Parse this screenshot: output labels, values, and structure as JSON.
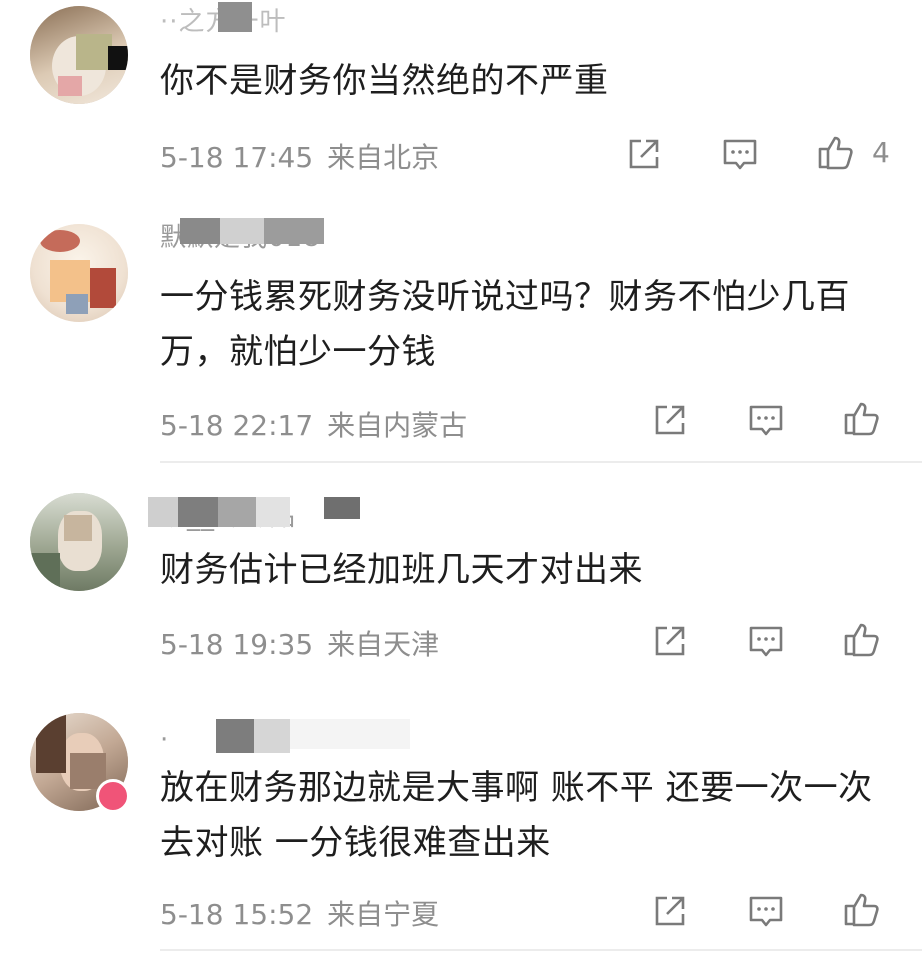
{
  "comments": [
    {
      "username": "··之方一叶",
      "text": "你不是财务你当然绝的不严重",
      "time": "5-18 17:45",
      "location": "来自北京",
      "likes": "4"
    },
    {
      "username": "默默是我018",
      "text": "一分钱累死财务没听说过吗？财务不怕少几百万，就怕少一分钱",
      "time": "5-18 22:17",
      "location": "来自内蒙古",
      "likes": ""
    },
    {
      "username": "珍__冬冬品",
      "text": "财务估计已经加班几天才对出来",
      "time": "5-18 19:35",
      "location": "来自天津",
      "likes": ""
    },
    {
      "username": "·",
      "text": "放在财务那边就是大事啊 账不平 还要一次一次去对账 一分钱很难查出来",
      "time": "5-18 15:52",
      "location": "来自宁夏",
      "likes": ""
    }
  ],
  "colors": {
    "text": "#1e1e1e",
    "meta": "#8e8e8e",
    "icon": "#7a7a7a",
    "divider": "#ececec",
    "vip_badge": "#f05478"
  },
  "icons": [
    "share-icon",
    "reply-icon",
    "like-icon"
  ]
}
